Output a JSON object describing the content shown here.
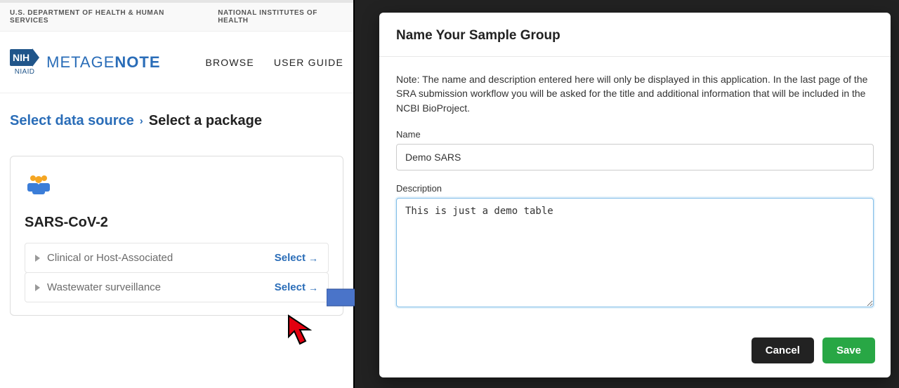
{
  "topbar": {
    "hhs": "U.S. DEPARTMENT OF HEALTH & HUMAN SERVICES",
    "nih": "NATIONAL INSTITUTES OF HEALTH"
  },
  "brand": {
    "nih_box": "NIH",
    "niaid": "NIAID",
    "app_prefix": "METAGE",
    "app_bold": "NOTE"
  },
  "nav": {
    "browse": "BROWSE",
    "guide": "USER GUIDE"
  },
  "breadcrumb": {
    "prev": "Select data source",
    "sep": "›",
    "current": "Select a package"
  },
  "card": {
    "title": "SARS-CoV-2",
    "options": [
      {
        "label": "Clinical or Host-Associated",
        "action": "Select"
      },
      {
        "label": "Wastewater surveillance",
        "action": "Select"
      }
    ]
  },
  "modal": {
    "title": "Name Your Sample Group",
    "note": "Note: The name and description entered here will only be displayed in this application. In the last page of the SRA submission workflow you will be asked for the title and additional information that will be included in the NCBI BioProject.",
    "name_label": "Name",
    "name_value": "Demo SARS",
    "desc_label": "Description",
    "desc_value": "This is just a demo table",
    "cancel": "Cancel",
    "save": "Save"
  }
}
